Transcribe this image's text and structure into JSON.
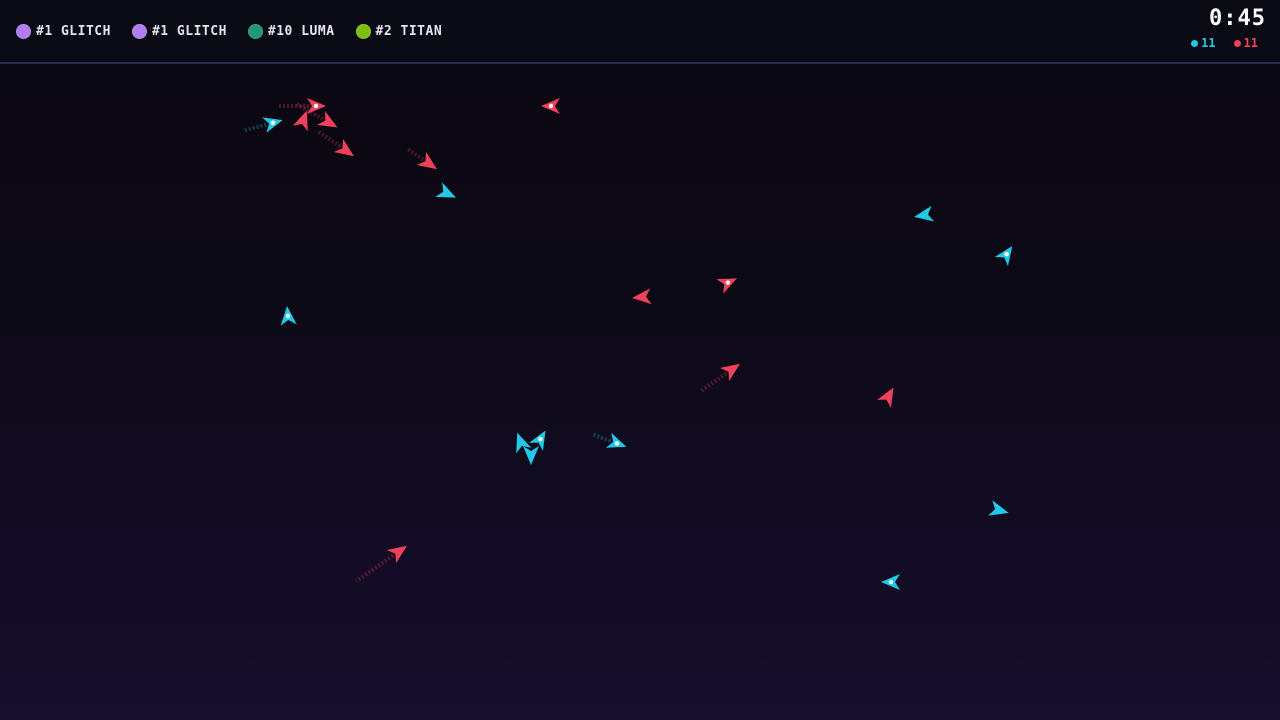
{
  "hud": {
    "players": [
      {
        "tag": "#1 GLITCH",
        "color": "#b07cf0"
      },
      {
        "tag": "#1 GLITCH",
        "color": "#b07cf0"
      },
      {
        "tag": "#10 LUMA",
        "color": "#1f9a78"
      },
      {
        "tag": "#2 TITAN",
        "color": "#7cbf12"
      }
    ],
    "timer": "0:45",
    "scores": [
      {
        "value": "11",
        "color": "#22c8e8"
      },
      {
        "value": "11",
        "color": "#f0405a"
      }
    ]
  },
  "colors": {
    "team_cyan": "#22c8e8",
    "team_red": "#f0405a"
  }
}
